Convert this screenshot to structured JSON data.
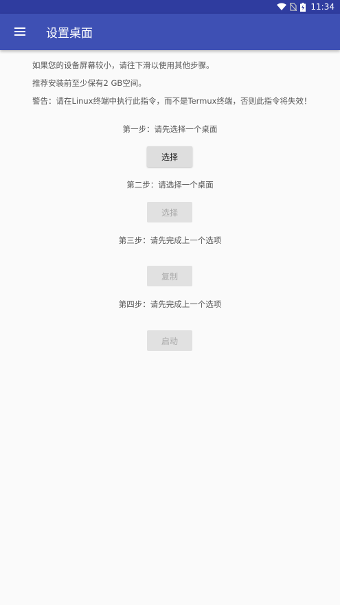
{
  "status_bar": {
    "time": "11:34",
    "icons": [
      "wifi-icon",
      "no-sim-icon",
      "battery-charging-icon"
    ]
  },
  "app_bar": {
    "menu_icon": "menu-icon",
    "title": "设置桌面"
  },
  "info": {
    "line1": "如果您的设备屏幕较小，请往下滑以使用其他步骤。",
    "line2": "推荐安装前至少保有2 GB空间。",
    "line3": "警告：请在Linux终端中执行此指令，而不是Termux终端，否则此指令将失效！"
  },
  "steps": [
    {
      "label": "第一步：请先选择一个桌面",
      "button": "选择",
      "enabled": true
    },
    {
      "label": "第二步：请选择一个桌面",
      "button": "选择",
      "enabled": false
    },
    {
      "label": "第三步：请先完成上一个选项",
      "button": "复制",
      "enabled": false
    },
    {
      "label": "第四步：请先完成上一个选项",
      "button": "启动",
      "enabled": false
    }
  ],
  "colors": {
    "status_bar": "#2f3c9f",
    "app_bar": "#3e50b4",
    "background": "#fafafa"
  }
}
